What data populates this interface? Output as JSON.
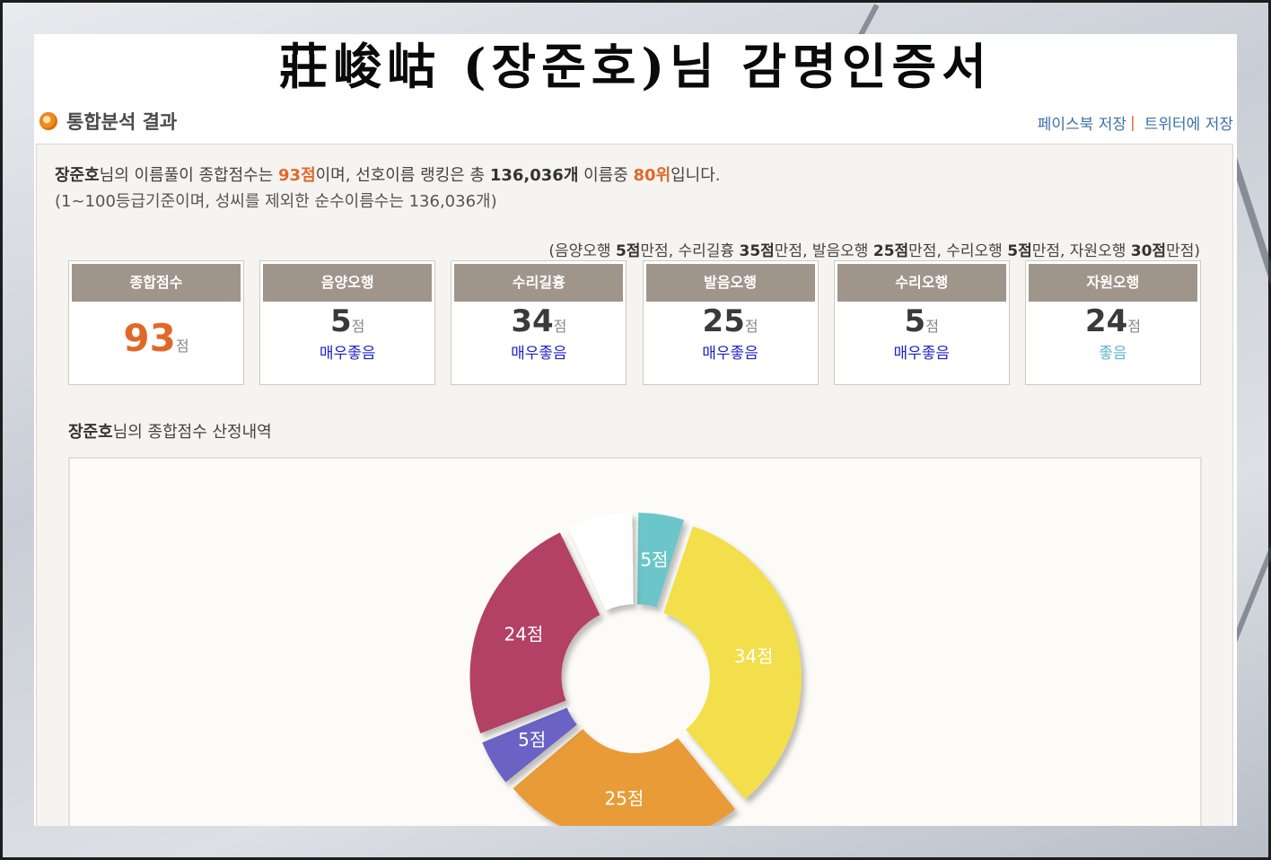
{
  "certificate": {
    "title": "莊峻岵 (장준호)님 감명인증서"
  },
  "section": {
    "title": "통합분석 결과",
    "share_facebook": "페이스북 저장",
    "share_sep": "|",
    "share_twitter": "트위터에 저장"
  },
  "summary": {
    "name": "장준호",
    "t1": "님의 이름풀이 종합점수는 ",
    "score": "93점",
    "t2": "이며, 선호이름 랭킹은 총 ",
    "total_names": "136,036개",
    "t3": " 이름중 ",
    "rank": "80위",
    "t4": "입니다.",
    "line2": "(1~100등급기준이며, 성씨를 제외한 순수이름수는 136,036개)"
  },
  "max_note": {
    "p1": "(음양오행 ",
    "v1": "5점",
    "p2": "만점, 수리길흉 ",
    "v2": "35점",
    "p3": "만점, 발음오행 ",
    "v3": "25점",
    "p4": "만점, 수리오행 ",
    "v4": "5점",
    "p5": "만점, 자원오행 ",
    "v5": "30점",
    "p6": "만점)"
  },
  "score_boxes": [
    {
      "label": "종합점수",
      "value": "93",
      "unit": "점",
      "grade": "",
      "grade_color": ""
    },
    {
      "label": "음양오행",
      "value": "5",
      "unit": "점",
      "grade": "매우좋음",
      "grade_color": "#1f1fc8"
    },
    {
      "label": "수리길흉",
      "value": "34",
      "unit": "점",
      "grade": "매우좋음",
      "grade_color": "#1f1fc8"
    },
    {
      "label": "발음오행",
      "value": "25",
      "unit": "점",
      "grade": "매우좋음",
      "grade_color": "#1f1fc8"
    },
    {
      "label": "수리오행",
      "value": "5",
      "unit": "점",
      "grade": "매우좋음",
      "grade_color": "#1f1fc8"
    },
    {
      "label": "자원오행",
      "value": "24",
      "unit": "점",
      "grade": "좋음",
      "grade_color": "#5fb3c9"
    }
  ],
  "breakdown": {
    "name": "장준호",
    "text": "님의 종합점수 산정내역"
  },
  "chart_data": {
    "type": "pie",
    "max_total": 100,
    "slices": [
      {
        "label": "5점",
        "value": 5,
        "color": "#6cc6c9"
      },
      {
        "label": "34점",
        "value": 34,
        "color": "#f3de4b"
      },
      {
        "label": "25점",
        "value": 25,
        "color": "#e99b38"
      },
      {
        "label": "5점",
        "value": 5,
        "color": "#6b63c5"
      },
      {
        "label": "24점",
        "value": 24,
        "color": "#b34065"
      },
      {
        "label": "",
        "value": 7,
        "color": "#ffffff"
      }
    ]
  }
}
